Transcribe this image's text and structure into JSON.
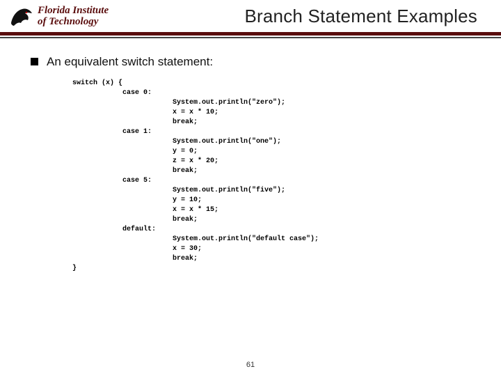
{
  "header": {
    "institution_line1": "Florida Institute",
    "institution_line2": "of Technology",
    "title": "Branch Statement Examples"
  },
  "bullet": {
    "text": "An equivalent switch statement:"
  },
  "code": {
    "line01": "switch (x) {",
    "line02": "            case 0:",
    "line03": "                        System.out.println(\"zero\");",
    "line04": "                        x = x * 10;",
    "line05": "                        break;",
    "line06": "            case 1:",
    "line07": "                        System.out.println(\"one\");",
    "line08": "                        y = 0;",
    "line09": "                        z = x * 20;",
    "line10": "                        break;",
    "line11": "            case 5:",
    "line12": "                        System.out.println(\"five\");",
    "line13": "                        y = 10;",
    "line14": "                        x = x * 15;",
    "line15": "                        break;",
    "line16": "            default:",
    "line17": "                        System.out.println(\"default case\");",
    "line18": "                        x = 30;",
    "line19": "                        break;",
    "line20": "}"
  },
  "page_number": "61"
}
